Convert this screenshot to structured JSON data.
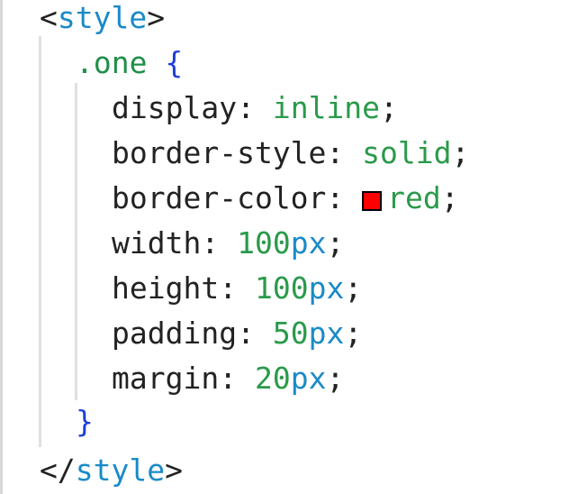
{
  "code": {
    "open_tag": {
      "lt": "<",
      "name": "style",
      "gt": ">"
    },
    "selector": ".one",
    "open_brace": "{",
    "declarations": [
      {
        "property": "display",
        "colon": ":",
        "value": "inline",
        "semicolon": ";"
      },
      {
        "property": "border-style",
        "colon": ":",
        "value": "solid",
        "semicolon": ";"
      },
      {
        "property": "border-color",
        "colon": ":",
        "value": "red",
        "semicolon": ";",
        "swatch_color": "#ff0000"
      },
      {
        "property": "width",
        "colon": ":",
        "number": "100",
        "unit": "px",
        "semicolon": ";"
      },
      {
        "property": "height",
        "colon": ":",
        "number": "100",
        "unit": "px",
        "semicolon": ";"
      },
      {
        "property": "padding",
        "colon": ":",
        "number": "50",
        "unit": "px",
        "semicolon": ";"
      },
      {
        "property": "margin",
        "colon": ":",
        "number": "20",
        "unit": "px",
        "semicolon": ";"
      }
    ],
    "close_brace": "}",
    "close_tag": {
      "lt": "</",
      "name": "style",
      "gt": ">"
    }
  },
  "colors": {
    "tag": "#1a8ac8",
    "selector": "#1f8f4a",
    "brace": "#1d3fd6",
    "keyword_value": "#2a9a4a",
    "unit": "#1a8ac8",
    "swatch": "#ff0000"
  }
}
